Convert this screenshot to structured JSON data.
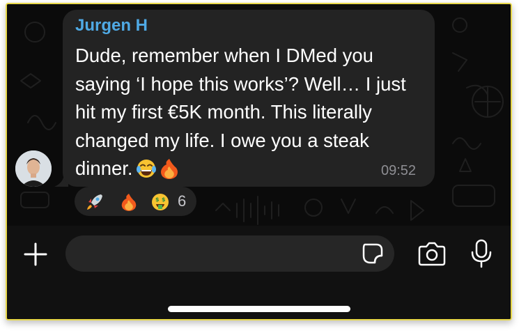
{
  "conversation": {
    "sender_name": "Jurgen H",
    "message_text": "Dude, remember when I DMed you saying ‘I hope this works’? Well… I just hit my first €5K month. This literally changed my life. I owe you a steak dinner.",
    "message_emojis": [
      "laughing-with-tears",
      "fire"
    ],
    "time": "09:52",
    "reactions": {
      "emojis": [
        "rocket",
        "fire",
        "money-mouth-face"
      ],
      "count": "6"
    }
  },
  "composer": {
    "input_value": "",
    "icons": [
      "plus-icon",
      "sticker-icon",
      "camera-icon",
      "microphone-icon"
    ]
  },
  "colors": {
    "sender_name": "#4fa9e4",
    "bubble": "#232323",
    "background": "#0b0b0b",
    "frame_border": "#e8d84a"
  }
}
